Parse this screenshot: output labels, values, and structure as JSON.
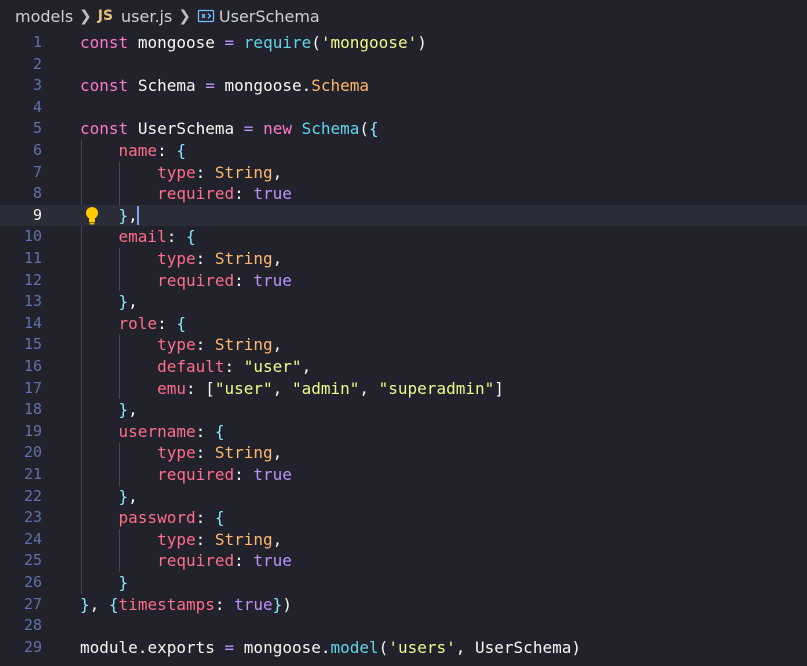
{
  "breadcrumb": {
    "folder": "models",
    "file_badge": "JS",
    "file": "user.js",
    "symbol": "UserSchema"
  },
  "editor": {
    "active_line": 9,
    "lines": [
      {
        "n": "1",
        "t": "const mongoose = require('mongoose')"
      },
      {
        "n": "2",
        "t": ""
      },
      {
        "n": "3",
        "t": "const Schema = mongoose.Schema"
      },
      {
        "n": "4",
        "t": ""
      },
      {
        "n": "5",
        "t": "const UserSchema = new Schema({"
      },
      {
        "n": "6",
        "t": "    name: {"
      },
      {
        "n": "7",
        "t": "        type: String,"
      },
      {
        "n": "8",
        "t": "        required: true"
      },
      {
        "n": "9",
        "t": "    },"
      },
      {
        "n": "10",
        "t": "    email: {"
      },
      {
        "n": "11",
        "t": "        type: String,"
      },
      {
        "n": "12",
        "t": "        required: true"
      },
      {
        "n": "13",
        "t": "    },"
      },
      {
        "n": "14",
        "t": "    role: {"
      },
      {
        "n": "15",
        "t": "        type: String,"
      },
      {
        "n": "16",
        "t": "        default: \"user\","
      },
      {
        "n": "17",
        "t": "        emu: [\"user\", \"admin\", \"superadmin\"]"
      },
      {
        "n": "18",
        "t": "    },"
      },
      {
        "n": "19",
        "t": "    username: {"
      },
      {
        "n": "20",
        "t": "        type: String,"
      },
      {
        "n": "21",
        "t": "        required: true"
      },
      {
        "n": "22",
        "t": "    },"
      },
      {
        "n": "23",
        "t": "    password: {"
      },
      {
        "n": "24",
        "t": "        type: String,"
      },
      {
        "n": "25",
        "t": "        required: true"
      },
      {
        "n": "26",
        "t": "    }"
      },
      {
        "n": "27",
        "t": "}, {timestamps: true})"
      },
      {
        "n": "28",
        "t": ""
      },
      {
        "n": "29",
        "t": "module.exports = mongoose.model('users', UserSchema)"
      }
    ]
  }
}
